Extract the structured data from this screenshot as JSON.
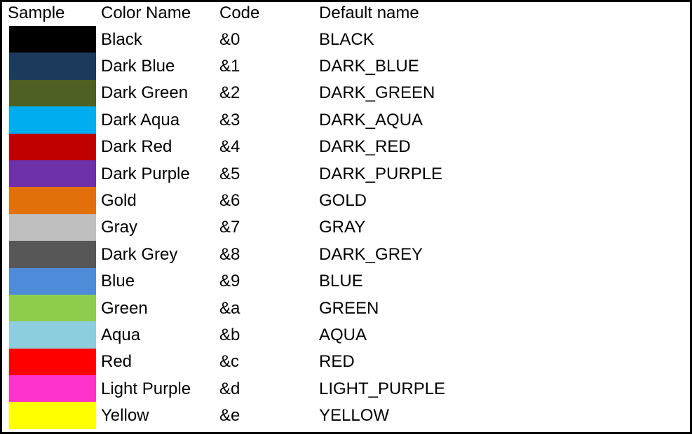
{
  "table": {
    "headers": {
      "sample": "Sample",
      "color_name": "Color Name",
      "code": "Code",
      "default_name": "Default name"
    },
    "rows": [
      {
        "color_name": "Black",
        "code": "&0",
        "default_name": "BLACK",
        "swatch_hex": "#000000"
      },
      {
        "color_name": "Dark Blue",
        "code": "&1",
        "default_name": "DARK_BLUE",
        "swatch_hex": "#1B3A5C"
      },
      {
        "color_name": "Dark Green",
        "code": "&2",
        "default_name": "DARK_GREEN",
        "swatch_hex": "#4E6123"
      },
      {
        "color_name": "Dark Aqua",
        "code": "&3",
        "default_name": "DARK_AQUA",
        "swatch_hex": "#00AEEF"
      },
      {
        "color_name": "Dark Red",
        "code": "&4",
        "default_name": "DARK_RED",
        "swatch_hex": "#C00000"
      },
      {
        "color_name": "Dark Purple",
        "code": "&5",
        "default_name": "DARK_PURPLE",
        "swatch_hex": "#6E30A8"
      },
      {
        "color_name": "Gold",
        "code": "&6",
        "default_name": "GOLD",
        "swatch_hex": "#E2700A"
      },
      {
        "color_name": "Gray",
        "code": "&7",
        "default_name": "GRAY",
        "swatch_hex": "#BFBFBF"
      },
      {
        "color_name": "Dark Grey",
        "code": "&8",
        "default_name": "DARK_GREY",
        "swatch_hex": "#575757"
      },
      {
        "color_name": "Blue",
        "code": "&9",
        "default_name": "BLUE",
        "swatch_hex": "#4E8CD9"
      },
      {
        "color_name": "Green",
        "code": "&a",
        "default_name": "GREEN",
        "swatch_hex": "#8DCC4C"
      },
      {
        "color_name": "Aqua",
        "code": "&b",
        "default_name": "AQUA",
        "swatch_hex": "#8CCDDE"
      },
      {
        "color_name": "Red",
        "code": "&c",
        "default_name": "RED",
        "swatch_hex": "#FF0000"
      },
      {
        "color_name": "Light Purple",
        "code": "&d",
        "default_name": "LIGHT_PURPLE",
        "swatch_hex": "#FF33CC"
      },
      {
        "color_name": "Yellow",
        "code": "&e",
        "default_name": "YELLOW",
        "swatch_hex": "#FFFF00"
      }
    ]
  },
  "style": {
    "border_color": "#000000",
    "background": "#ffffff",
    "text_color": "#000000"
  }
}
